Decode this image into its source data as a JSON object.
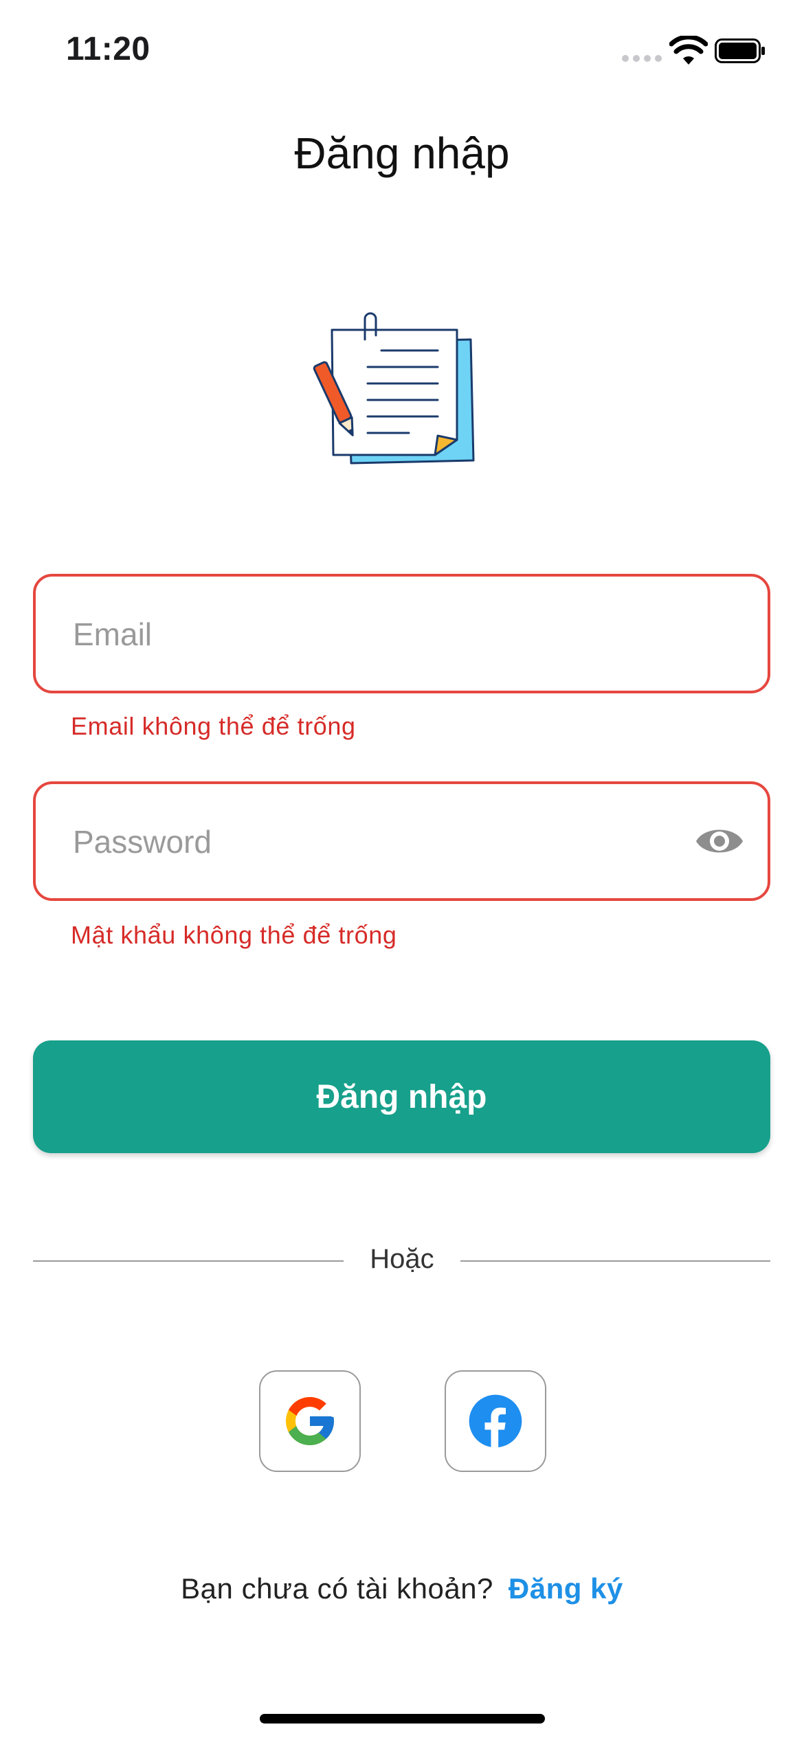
{
  "status_bar": {
    "time": "11:20"
  },
  "header": {
    "title": "Đăng nhập"
  },
  "form": {
    "email": {
      "placeholder": "Email",
      "value": "",
      "error": "Email không thể để trống"
    },
    "password": {
      "placeholder": "Password",
      "value": "",
      "error": "Mật khẩu không thể để trống"
    },
    "submit_label": "Đăng nhập"
  },
  "divider": {
    "label": "Hoặc"
  },
  "social": [
    {
      "name": "Google",
      "icon": "google-icon"
    },
    {
      "name": "Facebook",
      "icon": "facebook-icon"
    }
  ],
  "footer": {
    "prompt": "Bạn chưa có tài khoản?",
    "signup_label": "Đăng ký"
  },
  "colors": {
    "primary": "#17a08b",
    "error": "#d62b28",
    "error_border": "#e5473f",
    "link": "#1e90e6",
    "divider": "#9a9a9a"
  }
}
